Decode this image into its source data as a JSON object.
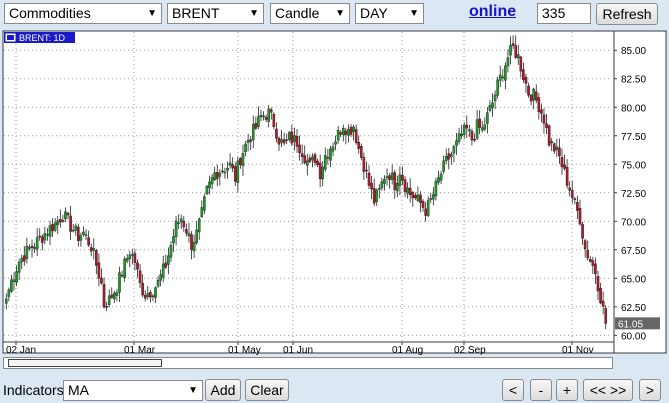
{
  "toolbar": {
    "market": "Commodities",
    "symbol": "BRENT",
    "chart_style": "Candle",
    "interval": "DAY",
    "online_label": "online",
    "bar_count": "335",
    "refresh_label": "Refresh"
  },
  "chart_header": {
    "label": "BRENT: 1D"
  },
  "chart_data": {
    "type": "candlestick",
    "series_label": "BRENT: 1D",
    "last_value_label": "61.05",
    "last_value": 61.05,
    "x_tick_labels": [
      "02 Jan",
      "01 Mar",
      "01 May",
      "01 Jun",
      "01 Aug",
      "02 Sep",
      "01 Nov"
    ],
    "y_tick_labels": [
      "85.00",
      "82.50",
      "80.00",
      "77.50",
      "75.00",
      "72.50",
      "70.00",
      "67.50",
      "65.00",
      "62.50",
      "60.00"
    ],
    "ylim": [
      59.5,
      86.6
    ],
    "grid": true,
    "up_color": "#1f9a2a",
    "down_color": "#b0182c",
    "close_path": [
      [
        0,
        63.2
      ],
      [
        2,
        64.8
      ],
      [
        5,
        66.5
      ],
      [
        9,
        67.6
      ],
      [
        13,
        68.4
      ],
      [
        16,
        69.2
      ],
      [
        19,
        69.8
      ],
      [
        22,
        70.6
      ],
      [
        25,
        69.6
      ],
      [
        28,
        68.7
      ],
      [
        30,
        69.0
      ],
      [
        33,
        67.8
      ],
      [
        35,
        66.2
      ],
      [
        37,
        64.5
      ],
      [
        38,
        62.7
      ],
      [
        40,
        63.1
      ],
      [
        43,
        64.3
      ],
      [
        46,
        66.2
      ],
      [
        48,
        67.4
      ],
      [
        50,
        66.5
      ],
      [
        52,
        64.4
      ],
      [
        54,
        63.6
      ],
      [
        57,
        64.0
      ],
      [
        59,
        64.6
      ],
      [
        62,
        66.2
      ],
      [
        64,
        67.9
      ],
      [
        66,
        69.6
      ],
      [
        68,
        70.3
      ],
      [
        70,
        69.3
      ],
      [
        72,
        68.0
      ],
      [
        74,
        68.9
      ],
      [
        76,
        70.6
      ],
      [
        78,
        72.6
      ],
      [
        81,
        74.2
      ],
      [
        84,
        74.6
      ],
      [
        87,
        74.9
      ],
      [
        89,
        73.8
      ],
      [
        91,
        75.6
      ],
      [
        94,
        77.2
      ],
      [
        97,
        78.2
      ],
      [
        99,
        79.2
      ],
      [
        102,
        79.5
      ],
      [
        104,
        78.6
      ],
      [
        106,
        77.2
      ],
      [
        108,
        76.6
      ],
      [
        110,
        77.3
      ],
      [
        113,
        77.0
      ],
      [
        115,
        76.2
      ],
      [
        118,
        74.8
      ],
      [
        120,
        75.6
      ],
      [
        122,
        74.3
      ],
      [
        124,
        75.8
      ],
      [
        127,
        76.9
      ],
      [
        129,
        77.6
      ],
      [
        131,
        78.6
      ],
      [
        133,
        77.9
      ],
      [
        135,
        78.4
      ],
      [
        137,
        76.4
      ],
      [
        139,
        75.0
      ],
      [
        141,
        73.2
      ],
      [
        143,
        71.8
      ],
      [
        145,
        72.6
      ],
      [
        147,
        74.0
      ],
      [
        149,
        74.2
      ],
      [
        151,
        73.3
      ],
      [
        153,
        74.5
      ],
      [
        155,
        73.2
      ],
      [
        157,
        72.4
      ],
      [
        159,
        72.0
      ],
      [
        161,
        71.6
      ],
      [
        163,
        71.0
      ],
      [
        165,
        71.7
      ],
      [
        167,
        73.0
      ],
      [
        169,
        74.2
      ],
      [
        171,
        75.2
      ],
      [
        173,
        75.9
      ],
      [
        175,
        76.7
      ],
      [
        177,
        77.6
      ],
      [
        179,
        78.0
      ],
      [
        181,
        77.2
      ],
      [
        183,
        78.3
      ],
      [
        185,
        78.0
      ],
      [
        187,
        79.2
      ],
      [
        189,
        80.4
      ],
      [
        191,
        81.9
      ],
      [
        193,
        83.2
      ],
      [
        195,
        84.4
      ],
      [
        197,
        85.2
      ],
      [
        199,
        84.4
      ],
      [
        201,
        82.8
      ],
      [
        203,
        81.3
      ],
      [
        205,
        81.0
      ],
      [
        207,
        80.2
      ],
      [
        209,
        79.0
      ],
      [
        211,
        77.0
      ],
      [
        213,
        76.4
      ],
      [
        215,
        75.6
      ],
      [
        217,
        74.2
      ],
      [
        219,
        72.9
      ],
      [
        221,
        71.4
      ],
      [
        223,
        70.3
      ],
      [
        225,
        67.6
      ],
      [
        227,
        66.6
      ],
      [
        229,
        65.6
      ],
      [
        231,
        63.4
      ],
      [
        233,
        61.05
      ]
    ]
  },
  "indicators": {
    "label": "Indicators",
    "selected": "MA",
    "add_label": "Add",
    "clear_label": "Clear"
  },
  "navigation": {
    "back_label": "<",
    "zoom_out_label": "-",
    "zoom_in_label": "+",
    "fit_label": "<< >>",
    "forward_label": ">"
  }
}
